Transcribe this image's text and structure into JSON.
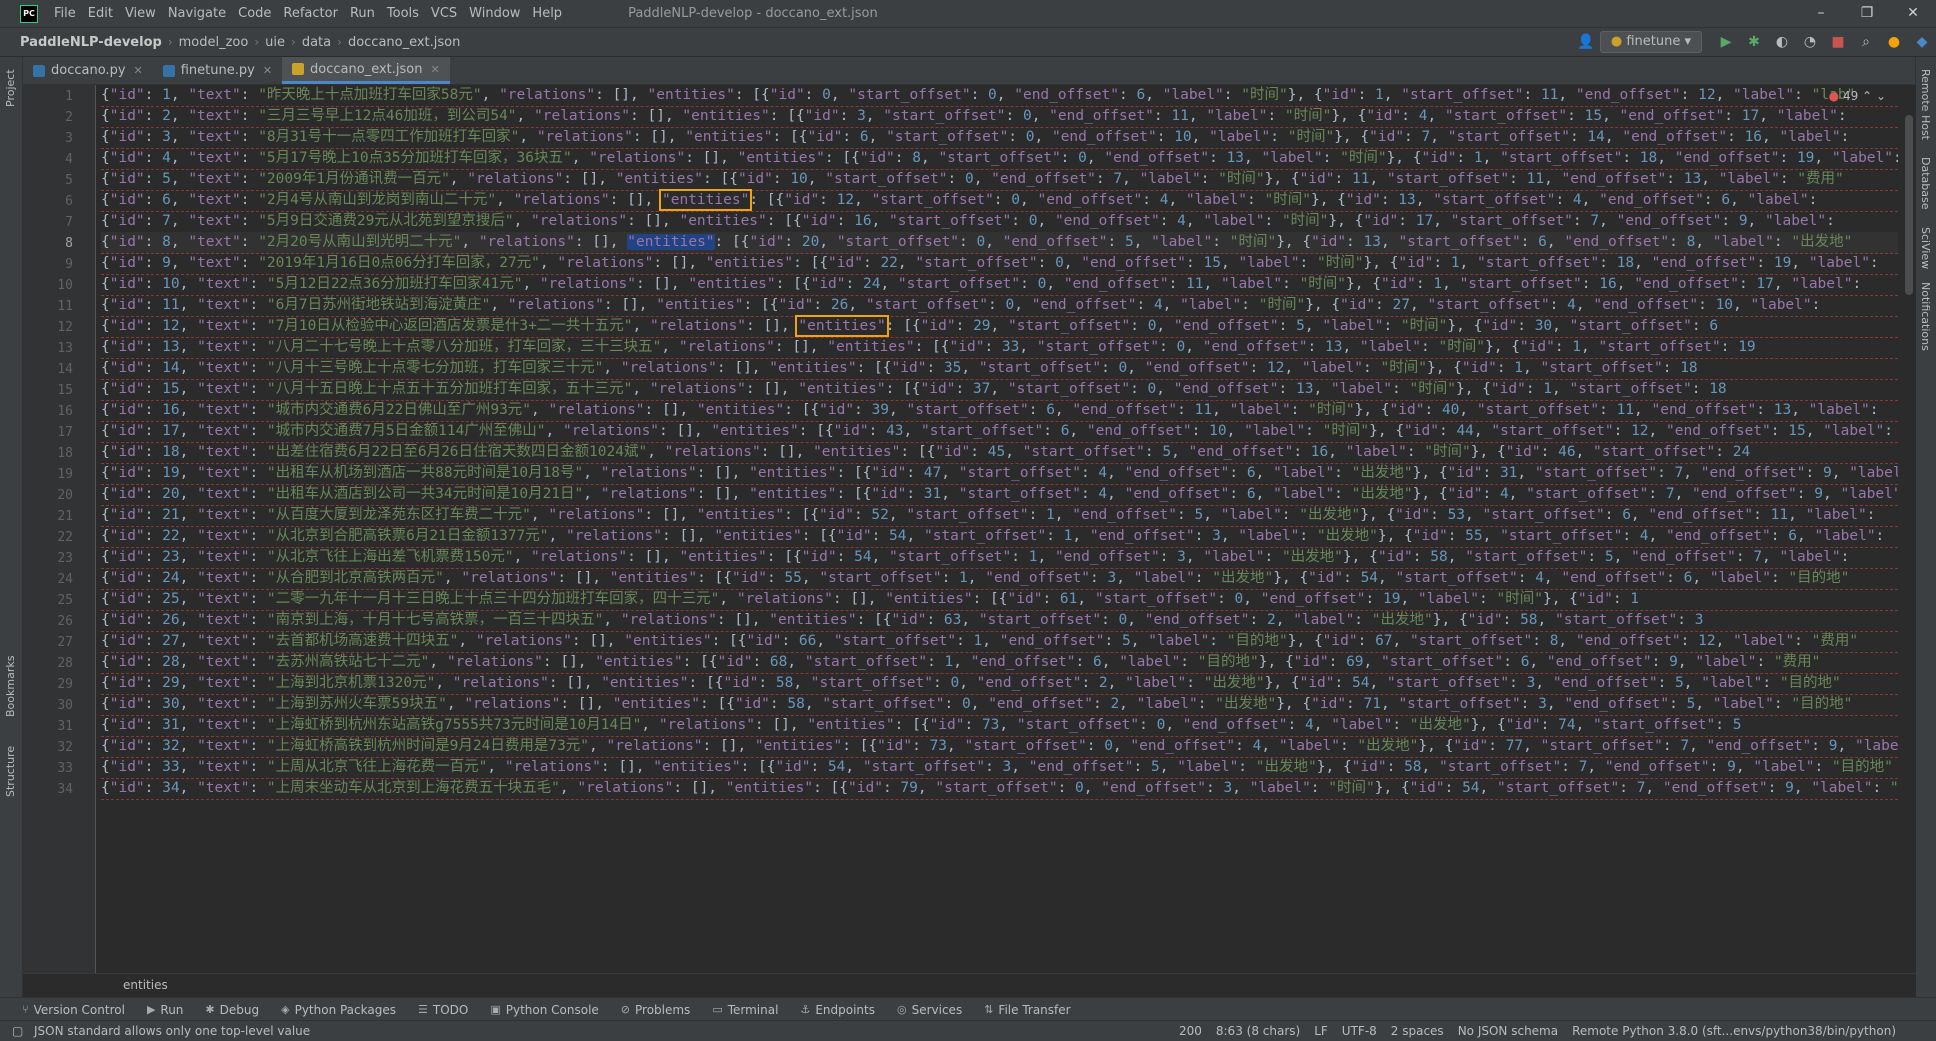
{
  "app": {
    "logo": "PC",
    "menus": [
      "File",
      "Edit",
      "View",
      "Navigate",
      "Code",
      "Refactor",
      "Run",
      "Tools",
      "VCS",
      "Window",
      "Help"
    ],
    "title": "PaddleNLP-develop - doccano_ext.json"
  },
  "navbar": {
    "breadcrumbs": [
      "PaddleNLP-develop",
      "model_zoo",
      "uie",
      "data",
      "doccano_ext.json"
    ],
    "run_config": "finetune"
  },
  "tabs": [
    {
      "label": "doccano.py",
      "color": "#3572a5"
    },
    {
      "label": "finetune.py",
      "color": "#3572a5"
    },
    {
      "label": "doccano_ext.json",
      "color": "#c9a227"
    }
  ],
  "side_panels": {
    "left": [
      "Project",
      "Bookmarks",
      "Structure"
    ],
    "right": [
      "Remote Host",
      "Database",
      "SciView",
      "Notifications"
    ]
  },
  "editor": {
    "error_count": "49",
    "current_line": 8,
    "lines": [
      [
        "1",
        "昨天晚上十点加班打车回家58元",
        [
          [
            "0",
            "0",
            "6",
            "时间"
          ],
          [
            "1",
            "11",
            "12",
            "lab"
          ]
        ]
      ],
      [
        "2",
        "三月三号早上12点46加班，到公司54",
        [
          [
            "3",
            "0",
            "11",
            "时间"
          ],
          [
            "4",
            "15",
            "17",
            ""
          ]
        ]
      ],
      [
        "3",
        "8月31号十一点零四工作加班打车回家",
        [
          [
            "6",
            "0",
            "10",
            "时间"
          ],
          [
            "7",
            "14",
            "16",
            ""
          ]
        ]
      ],
      [
        "4",
        "5月17号晚上10点35分加班打车回家，36块五",
        [
          [
            "8",
            "0",
            "13",
            "时间"
          ],
          [
            "1",
            "18",
            "19",
            ""
          ]
        ]
      ],
      [
        "5",
        "2009年1月份通讯费一百元",
        [
          [
            "10",
            "0",
            "7",
            "时间"
          ],
          [
            "11",
            "11",
            "13",
            "费用"
          ]
        ]
      ],
      [
        "6",
        "2月4号从南山到龙岗到南山二十元",
        [
          [
            "12",
            "0",
            "4",
            "时间"
          ],
          [
            "13",
            "4",
            "6",
            ""
          ]
        ]
      ],
      [
        "7",
        "5月9日交通费29元从北苑到望京搜后",
        [
          [
            "16",
            "0",
            "4",
            "时间"
          ],
          [
            "17",
            "7",
            "9",
            ""
          ]
        ]
      ],
      [
        "8",
        "2月20号从南山到光明二十元",
        [
          [
            "20",
            "0",
            "5",
            "时间"
          ],
          [
            "13",
            "6",
            "8",
            "出发地"
          ]
        ]
      ],
      [
        "9",
        "2019年1月16日0点06分打车回家，27元",
        [
          [
            "22",
            "0",
            "15",
            "时间"
          ],
          [
            "1",
            "18",
            "19",
            ""
          ]
        ]
      ],
      [
        "10",
        "5月12日22点36分加班打车回家41元",
        [
          [
            "24",
            "0",
            "11",
            "时间"
          ],
          [
            "1",
            "16",
            "17",
            ""
          ]
        ]
      ],
      [
        "11",
        "6月7日苏州街地铁站到海淀黄庄",
        [
          [
            "26",
            "0",
            "4",
            "时间"
          ],
          [
            "27",
            "4",
            "10",
            ""
          ]
        ]
      ],
      [
        "12",
        "7月10日从检验中心返回酒店发票是什3+二一共十五元",
        [
          [
            "29",
            "0",
            "5",
            "时间"
          ],
          [
            "30",
            "6",
            ""
          ]
        ]
      ],
      [
        "13",
        "八月二十七号晚上十点零八分加班，打车回家，三十三块五",
        [
          [
            "33",
            "0",
            "13",
            "时间"
          ],
          [
            "1",
            "19",
            ""
          ]
        ]
      ],
      [
        "14",
        "八月十三号晚上十点零七分加班，打车回家三十元",
        [
          [
            "35",
            "0",
            "12",
            "时间"
          ],
          [
            "1",
            "18",
            ""
          ]
        ]
      ],
      [
        "15",
        "八月十五日晚上十点五十五分加班打车回家，五十三元",
        [
          [
            "37",
            "0",
            "13",
            "时间"
          ],
          [
            "1",
            "18",
            ""
          ]
        ]
      ],
      [
        "16",
        "城市内交通费6月22日佛山至广州93元",
        [
          [
            "39",
            "6",
            "11",
            "时间"
          ],
          [
            "40",
            "11",
            "13",
            ""
          ]
        ]
      ],
      [
        "17",
        "城市内交通费7月5日金额114广州至佛山",
        [
          [
            "43",
            "6",
            "10",
            "时间"
          ],
          [
            "44",
            "12",
            "15",
            ""
          ]
        ]
      ],
      [
        "18",
        "出差住宿费6月22日至6月26日住宿天数四日金额1024斌",
        [
          [
            "45",
            "5",
            "16",
            "时间"
          ],
          [
            "46",
            "24",
            ""
          ]
        ]
      ],
      [
        "19",
        "出租车从机场到酒店一共88元时间是10月18号",
        [
          [
            "47",
            "4",
            "6",
            "出发地"
          ],
          [
            "31",
            "7",
            "9",
            ""
          ]
        ]
      ],
      [
        "20",
        "出租车从酒店到公司一共34元时间是10月21日",
        [
          [
            "31",
            "4",
            "6",
            "出发地"
          ],
          [
            "4",
            "7",
            "9",
            ""
          ]
        ]
      ],
      [
        "21",
        "从百度大厦到龙泽苑东区打车费二十元",
        [
          [
            "52",
            "1",
            "5",
            "出发地"
          ],
          [
            "53",
            "6",
            "11",
            ""
          ]
        ]
      ],
      [
        "22",
        "从北京到合肥高铁票6月21日金额1377元",
        [
          [
            "54",
            "1",
            "3",
            "出发地"
          ],
          [
            "55",
            "4",
            "6",
            ""
          ]
        ]
      ],
      [
        "23",
        "从北京飞往上海出差飞机票费150元",
        [
          [
            "54",
            "1",
            "3",
            "出发地"
          ],
          [
            "58",
            "5",
            "7",
            ""
          ]
        ]
      ],
      [
        "24",
        "从合肥到北京高铁两百元",
        [
          [
            "55",
            "1",
            "3",
            "出发地"
          ],
          [
            "54",
            "4",
            "6",
            "目的地"
          ]
        ]
      ],
      [
        "25",
        "二零一九年十一月十三日晚上十点三十四分加班打车回家，四十三元",
        [
          [
            "61",
            "0",
            "19",
            "时间"
          ],
          [
            "1",
            ""
          ]
        ]
      ],
      [
        "26",
        "南京到上海，十月十七号高铁票，一百三十四块五",
        [
          [
            "63",
            "0",
            "2",
            "出发地"
          ],
          [
            "58",
            "3",
            ""
          ]
        ]
      ],
      [
        "27",
        "去首都机场高速费十四块五",
        [
          [
            "66",
            "1",
            "5",
            "目的地"
          ],
          [
            "67",
            "8",
            "12",
            "费用"
          ]
        ]
      ],
      [
        "28",
        "去苏州高铁站七十二元",
        [
          [
            "68",
            "1",
            "6",
            "目的地"
          ],
          [
            "69",
            "6",
            "9",
            "费用"
          ]
        ]
      ],
      [
        "29",
        "上海到北京机票1320元",
        [
          [
            "58",
            "0",
            "2",
            "出发地"
          ],
          [
            "54",
            "3",
            "5",
            "目的地"
          ]
        ]
      ],
      [
        "30",
        "上海到苏州火车票59块五",
        [
          [
            "58",
            "0",
            "2",
            "出发地"
          ],
          [
            "71",
            "3",
            "5",
            "目的地"
          ]
        ]
      ],
      [
        "31",
        "上海虹桥到杭州东站高铁g7555共73元时间是10月14日",
        [
          [
            "73",
            "0",
            "4",
            "出发地"
          ],
          [
            "74",
            "5",
            ""
          ]
        ]
      ],
      [
        "32",
        "上海虹桥高铁到杭州时间是9月24日费用是73元",
        [
          [
            "73",
            "0",
            "4",
            "出发地"
          ],
          [
            "77",
            "7",
            "9",
            ""
          ]
        ]
      ],
      [
        "33",
        "上周从北京飞往上海花费一百元",
        [
          [
            "54",
            "3",
            "5",
            "出发地"
          ],
          [
            "58",
            "7",
            "9",
            "目的地"
          ]
        ]
      ],
      [
        "34",
        "上周末坐动车从北京到上海花费五十块五毛",
        [
          [
            "79",
            "0",
            "3",
            "时间"
          ],
          [
            "54",
            "7",
            "9",
            "Labe"
          ]
        ]
      ]
    ],
    "footer_breadcrumb": "entities"
  },
  "tool_windows": [
    "Version Control",
    "Run",
    "Debug",
    "Python Packages",
    "TODO",
    "Python Console",
    "Problems",
    "Terminal",
    "Endpoints",
    "Services",
    "File Transfer"
  ],
  "status": {
    "message": "JSON standard allows only one top-level value",
    "items": [
      "200",
      "8:63 (8 chars)",
      "LF",
      "UTF-8",
      "2 spaces",
      "No JSON schema",
      "Remote Python 3.8.0 (sft...envs/python38/bin/python)"
    ]
  }
}
